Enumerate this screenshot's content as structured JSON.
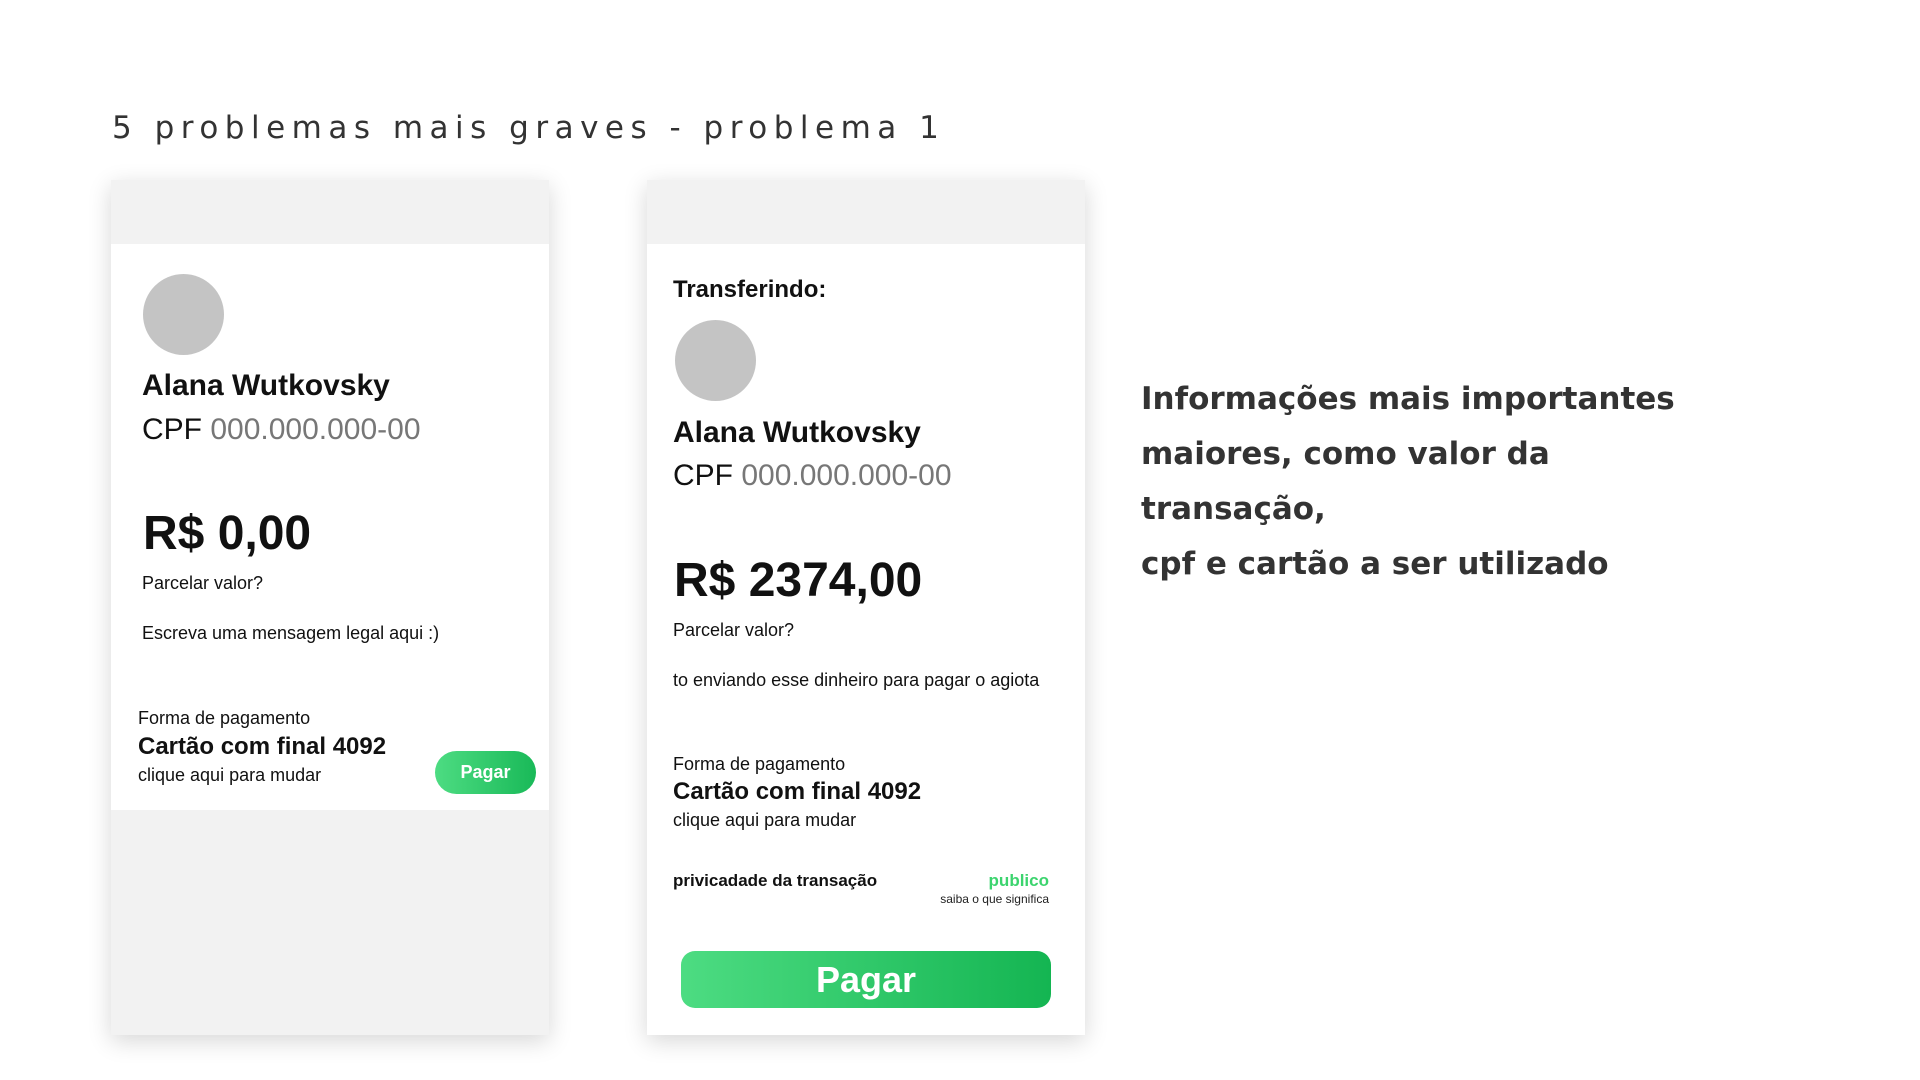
{
  "slide": {
    "title": "5 problemas mais graves - problema 1",
    "note_lines": [
      "Informações mais importantes",
      "maiores, como valor da transação,",
      "cpf  e cartão a ser utilizado"
    ]
  },
  "before": {
    "name": "Alana Wutkovsky",
    "cpf_label": "CPF",
    "cpf_value": "000.000.000-00",
    "amount": "R$ 0,00",
    "installments": "Parcelar valor?",
    "message": "Escreva uma mensagem legal aqui :)",
    "payment_label": "Forma de pagamento",
    "card": "Cartão com final 4092",
    "change": "clique aqui para mudar",
    "pay_button": "Pagar"
  },
  "after": {
    "heading": "Transferindo:",
    "name": "Alana Wutkovsky",
    "cpf_label": "CPF",
    "cpf_value": "000.000.000-00",
    "amount": "R$ 2374,00",
    "installments": "Parcelar valor?",
    "message": "to enviando esse dinheiro para pagar o agiota",
    "payment_label": "Forma de pagamento",
    "card": "Cartão com final 4092",
    "change": "clique aqui para mudar",
    "privacy_label": "privicadade da transação",
    "privacy_value": "publico",
    "privacy_help": "saiba o que significa",
    "pay_button": "Pagar"
  },
  "colors": {
    "accent_start": "#4ddc82",
    "accent_end": "#14b552",
    "privacy_green": "#3cd46e",
    "avatar_gray": "#c4c4c4",
    "panel_gray": "#f2f2f2"
  }
}
